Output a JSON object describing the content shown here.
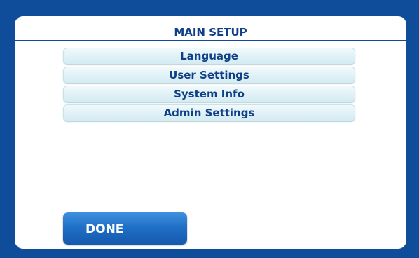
{
  "title": "MAIN SETUP",
  "menu": {
    "items": [
      {
        "label": "Language"
      },
      {
        "label": "User Settings"
      },
      {
        "label": "System Info"
      },
      {
        "label": "Admin Settings"
      }
    ]
  },
  "done_label": "DONE",
  "colors": {
    "frame": "#0f4c9a",
    "text": "#0f3f86",
    "menu_item_bg": "#e1f2f7",
    "done_button": "#1f6ec6"
  }
}
